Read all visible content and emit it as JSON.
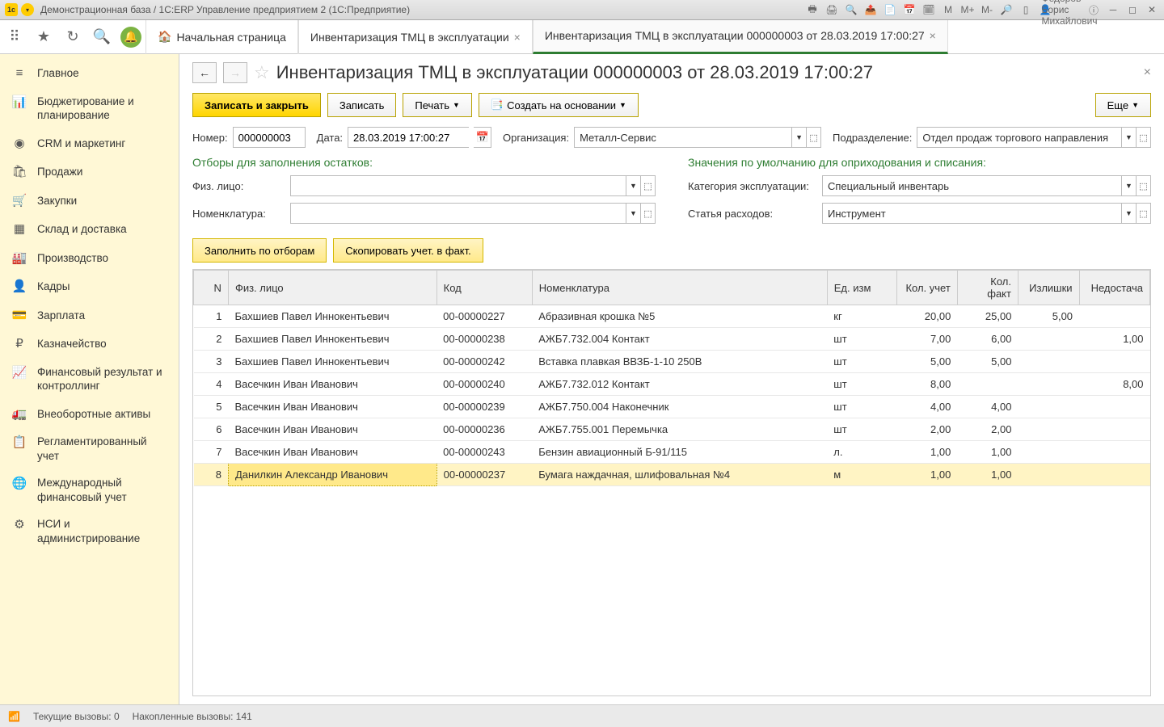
{
  "titlebar": {
    "title": "Демонстрационная база / 1С:ERP Управление предприятием 2  (1С:Предприятие)",
    "user": "Федоров Борис Михайлович",
    "m_labels": [
      "M",
      "M+",
      "M-"
    ]
  },
  "tabs": {
    "home": "Начальная страница",
    "tab1": "Инвентаризация ТМЦ в эксплуатации",
    "tab2": "Инвентаризация ТМЦ в эксплуатации 000000003 от 28.03.2019 17:00:27"
  },
  "sidebar": [
    {
      "icon": "≡",
      "label": "Главное"
    },
    {
      "icon": "📊",
      "label": "Бюджетирование и планирование"
    },
    {
      "icon": "◉",
      "label": "CRM и маркетинг"
    },
    {
      "icon": "🛍",
      "label": "Продажи"
    },
    {
      "icon": "🛒",
      "label": "Закупки"
    },
    {
      "icon": "▦",
      "label": "Склад и доставка"
    },
    {
      "icon": "🏭",
      "label": "Производство"
    },
    {
      "icon": "👤",
      "label": "Кадры"
    },
    {
      "icon": "💳",
      "label": "Зарплата"
    },
    {
      "icon": "₽",
      "label": "Казначейство"
    },
    {
      "icon": "📈",
      "label": "Финансовый результат и контроллинг"
    },
    {
      "icon": "🚛",
      "label": "Внеоборотные активы"
    },
    {
      "icon": "📋",
      "label": "Регламентированный учет"
    },
    {
      "icon": "🌐",
      "label": "Международный финансовый учет"
    },
    {
      "icon": "⚙",
      "label": "НСИ и администрирование"
    }
  ],
  "page": {
    "title": "Инвентаризация ТМЦ в эксплуатации 000000003 от 28.03.2019 17:00:27"
  },
  "buttons": {
    "save_close": "Записать и закрыть",
    "save": "Записать",
    "print": "Печать",
    "create_based": "Создать на основании",
    "more": "Еще",
    "fill": "Заполнить по отборам",
    "copy": "Скопировать учет. в факт."
  },
  "labels": {
    "number": "Номер:",
    "date": "Дата:",
    "org": "Организация:",
    "dept": "Подразделение:",
    "section_filter": "Отборы для заполнения остатков:",
    "section_defaults": "Значения по умолчанию для оприходования и списания:",
    "person": "Физ. лицо:",
    "nomenclature": "Номенклатура:",
    "category": "Категория эксплуатации:",
    "expense": "Статья расходов:"
  },
  "fields": {
    "number": "000000003",
    "date": "28.03.2019 17:00:27",
    "org": "Металл-Сервис",
    "dept": "Отдел продаж торгового направления",
    "person": "",
    "nomenclature": "",
    "category": "Специальный инвентарь",
    "expense": "Инструмент"
  },
  "table": {
    "headers": {
      "n": "N",
      "person": "Физ. лицо",
      "code": "Код",
      "nom": "Номенклатура",
      "unit": "Ед. изм",
      "qty_acc": "Кол. учет",
      "qty_fact": "Кол. факт",
      "surplus": "Излишки",
      "shortage": "Недостача"
    },
    "rows": [
      {
        "n": 1,
        "person": "Бахшиев Павел Иннокентьевич",
        "code": "00-00000227",
        "nom": "Абразивная крошка №5",
        "unit": "кг",
        "qa": "20,00",
        "qf": "25,00",
        "sur": "5,00",
        "sh": ""
      },
      {
        "n": 2,
        "person": "Бахшиев Павел Иннокентьевич",
        "code": "00-00000238",
        "nom": "АЖБ7.732.004 Контакт",
        "unit": "шт",
        "qa": "7,00",
        "qf": "6,00",
        "sur": "",
        "sh": "1,00"
      },
      {
        "n": 3,
        "person": "Бахшиев Павел Иннокентьевич",
        "code": "00-00000242",
        "nom": "Вставка плавкая ВВЗБ-1-10 250В",
        "unit": "шт",
        "qa": "5,00",
        "qf": "5,00",
        "sur": "",
        "sh": ""
      },
      {
        "n": 4,
        "person": "Васечкин Иван Иванович",
        "code": "00-00000240",
        "nom": "АЖБ7.732.012 Контакт",
        "unit": "шт",
        "qa": "8,00",
        "qf": "",
        "sur": "",
        "sh": "8,00"
      },
      {
        "n": 5,
        "person": "Васечкин Иван Иванович",
        "code": "00-00000239",
        "nom": "АЖБ7.750.004 Наконечник",
        "unit": "шт",
        "qa": "4,00",
        "qf": "4,00",
        "sur": "",
        "sh": ""
      },
      {
        "n": 6,
        "person": "Васечкин Иван Иванович",
        "code": "00-00000236",
        "nom": "АЖБ7.755.001 Перемычка",
        "unit": "шт",
        "qa": "2,00",
        "qf": "2,00",
        "sur": "",
        "sh": ""
      },
      {
        "n": 7,
        "person": "Васечкин Иван Иванович",
        "code": "00-00000243",
        "nom": "Бензин авиационный Б-91/115",
        "unit": "л.",
        "qa": "1,00",
        "qf": "1,00",
        "sur": "",
        "sh": ""
      },
      {
        "n": 8,
        "person": "Данилкин Александр Иванович",
        "code": "00-00000237",
        "nom": "Бумага наждачная, шлифовальная №4",
        "unit": "м",
        "qa": "1,00",
        "qf": "1,00",
        "sur": "",
        "sh": ""
      }
    ]
  },
  "statusbar": {
    "current": "Текущие вызовы: 0",
    "accumulated": "Накопленные вызовы: 141"
  }
}
